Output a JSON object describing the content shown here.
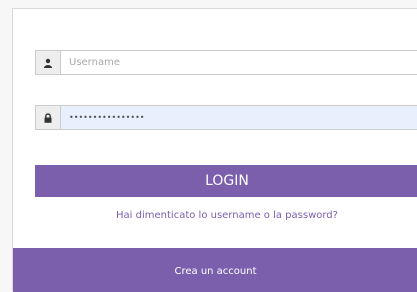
{
  "login_form": {
    "username": {
      "placeholder": "Username",
      "value": "",
      "icon": "user-icon"
    },
    "password": {
      "placeholder": "",
      "value": "••••••••••••••••",
      "icon": "lock-icon"
    },
    "login_label": "LOGIN",
    "forgot_label": "Hai dimenticato lo username o la password?",
    "create_account_label": "Crea un account"
  },
  "colors": {
    "accent": "#7b5fad",
    "autofill_background": "#e8f0fe",
    "addon_background": "#eeeeee"
  }
}
